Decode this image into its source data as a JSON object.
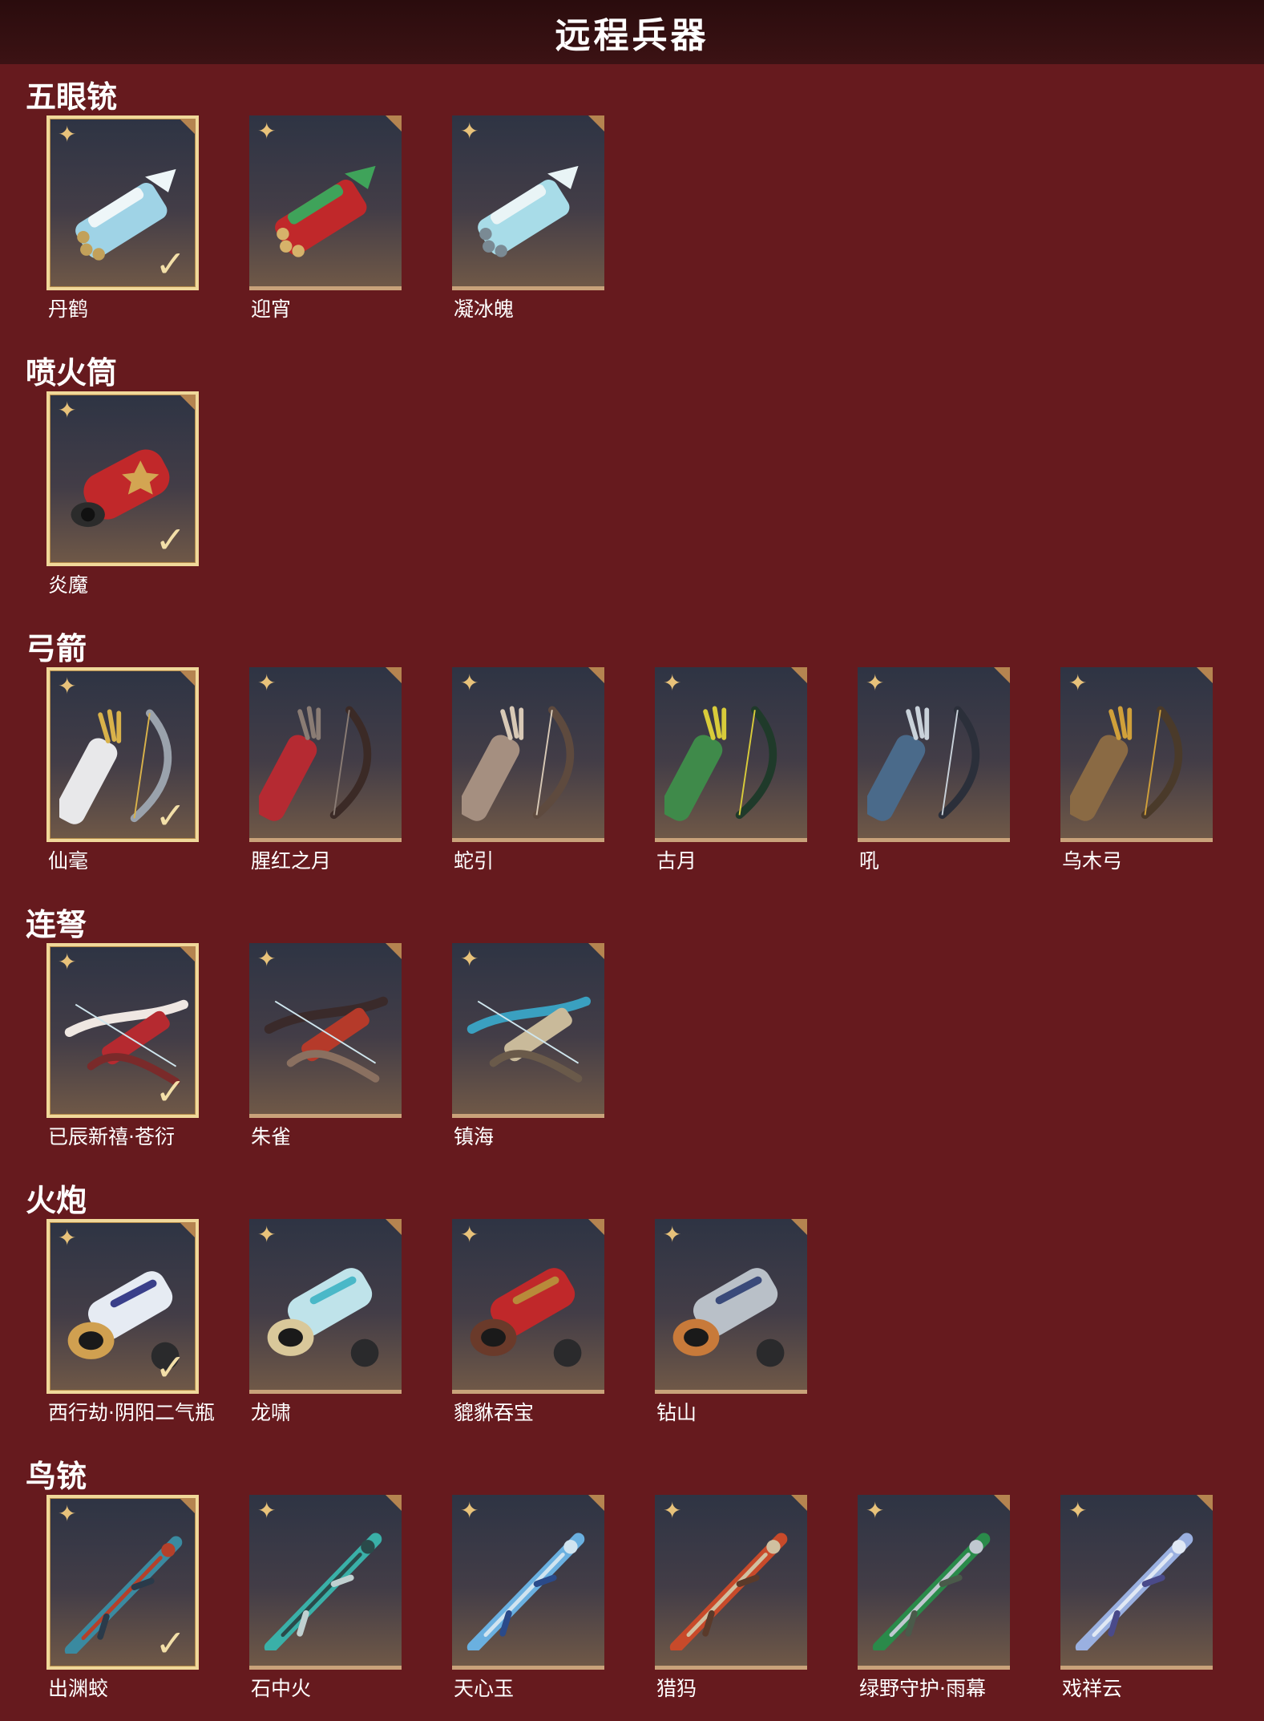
{
  "page": {
    "title": "远程兵器"
  },
  "categories": [
    {
      "name": "五眼铳",
      "items": [
        {
          "name": "丹鹤",
          "equipped": true,
          "icon": "hand-cannon-icon",
          "palette": [
            "#9fd3e6",
            "#eef6f8",
            "#c2a15a"
          ]
        },
        {
          "name": "迎宵",
          "equipped": false,
          "icon": "hand-cannon-icon",
          "palette": [
            "#c0282a",
            "#3fa35a",
            "#d6b26a"
          ]
        },
        {
          "name": "凝冰魄",
          "equipped": false,
          "icon": "hand-cannon-icon",
          "palette": [
            "#a8dce8",
            "#e9f4f6",
            "#7a8a94"
          ]
        }
      ]
    },
    {
      "name": "喷火筒",
      "items": [
        {
          "name": "炎魔",
          "equipped": true,
          "icon": "flamethrower-icon",
          "palette": [
            "#c1282a",
            "#2b2b2b",
            "#d3a552"
          ]
        }
      ]
    },
    {
      "name": "弓箭",
      "items": [
        {
          "name": "仙毫",
          "equipped": true,
          "icon": "bow-quiver-icon",
          "palette": [
            "#e8e8ea",
            "#d9b24a",
            "#9aa2ac"
          ]
        },
        {
          "name": "腥红之月",
          "equipped": false,
          "icon": "bow-quiver-icon",
          "palette": [
            "#b52a32",
            "#8a7c74",
            "#3b2a26"
          ]
        },
        {
          "name": "蛇引",
          "equipped": false,
          "icon": "bow-quiver-icon",
          "palette": [
            "#a58f80",
            "#d8c9b6",
            "#5e4a3e"
          ]
        },
        {
          "name": "古月",
          "equipped": false,
          "icon": "bow-quiver-icon",
          "palette": [
            "#3f8a4a",
            "#d9cc3a",
            "#1f3a2a"
          ]
        },
        {
          "name": "吼",
          "equipped": false,
          "icon": "bow-quiver-icon",
          "palette": [
            "#4a6a8a",
            "#c9d2da",
            "#2b2f3a"
          ]
        },
        {
          "name": "乌木弓",
          "equipped": false,
          "icon": "bow-quiver-icon",
          "palette": [
            "#8a6a44",
            "#d0a03a",
            "#4a3a2a"
          ]
        }
      ]
    },
    {
      "name": "连弩",
      "items": [
        {
          "name": "已辰新禧·苍衍",
          "equipped": true,
          "icon": "repeating-crossbow-icon",
          "palette": [
            "#b52a30",
            "#efe7e2",
            "#7a2a2a"
          ]
        },
        {
          "name": "朱雀",
          "equipped": false,
          "icon": "repeating-crossbow-icon",
          "palette": [
            "#b53a2a",
            "#3a2a2a",
            "#8a7060"
          ]
        },
        {
          "name": "镇海",
          "equipped": false,
          "icon": "repeating-crossbow-icon",
          "palette": [
            "#c9ba9a",
            "#3aa0c0",
            "#6a5a4a"
          ]
        }
      ]
    },
    {
      "name": "火炮",
      "items": [
        {
          "name": "西行劫·阴阳二气瓶",
          "equipped": true,
          "icon": "cannon-icon",
          "palette": [
            "#e6ebf3",
            "#3a3f8a",
            "#d0a050"
          ]
        },
        {
          "name": "龙啸",
          "equipped": false,
          "icon": "cannon-icon",
          "palette": [
            "#bfe3ea",
            "#4ab8c8",
            "#d9c89a"
          ]
        },
        {
          "name": "貔貅吞宝",
          "equipped": false,
          "icon": "cannon-icon",
          "palette": [
            "#c0282a",
            "#b88a3a",
            "#6a3a2a"
          ]
        },
        {
          "name": "钻山",
          "equipped": false,
          "icon": "cannon-icon",
          "palette": [
            "#b9c0c8",
            "#3a4a7a",
            "#c87a3a"
          ]
        }
      ]
    },
    {
      "name": "鸟铳",
      "items": [
        {
          "name": "出渊蛟",
          "equipped": true,
          "icon": "musket-icon",
          "palette": [
            "#3a8aa0",
            "#b5402a",
            "#2a3a4a"
          ]
        },
        {
          "name": "石中火",
          "equipped": false,
          "icon": "musket-icon",
          "palette": [
            "#3ab0a8",
            "#2a4a4a",
            "#c0d0d0"
          ]
        },
        {
          "name": "天心玉",
          "equipped": false,
          "icon": "musket-icon",
          "palette": [
            "#6ab0e0",
            "#d0e4f0",
            "#2a4a8a"
          ]
        },
        {
          "name": "猎犸",
          "equipped": false,
          "icon": "musket-icon",
          "palette": [
            "#c84a2a",
            "#d0c0a0",
            "#5a3a2a"
          ]
        },
        {
          "name": "绿野守护·雨幕",
          "equipped": false,
          "icon": "musket-icon",
          "palette": [
            "#2a8a4a",
            "#c0c8d0",
            "#4a5a4a"
          ]
        },
        {
          "name": "戏祥云",
          "equipped": false,
          "icon": "musket-icon",
          "palette": [
            "#9ab0e0",
            "#e0e8f4",
            "#4a4a8a"
          ]
        }
      ]
    }
  ],
  "icons": {
    "quality": "four-point-star-icon",
    "quality_glyph": "✦",
    "equipped": "check-icon",
    "equipped_glyph": "✓"
  }
}
